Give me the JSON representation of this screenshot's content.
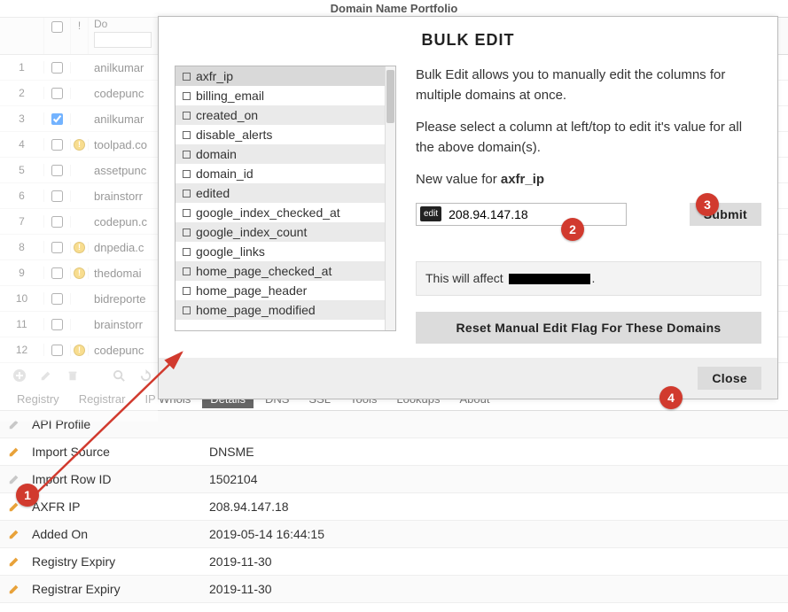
{
  "page_title": "Domain Name Portfolio",
  "grid": {
    "col_domain_label": "Do",
    "warn_label": "!",
    "rows": [
      {
        "n": "1",
        "chk": false,
        "warn": false,
        "domain": "anilkumar"
      },
      {
        "n": "2",
        "chk": false,
        "warn": false,
        "domain": "codepunc"
      },
      {
        "n": "3",
        "chk": true,
        "warn": false,
        "domain": "anilkumar"
      },
      {
        "n": "4",
        "chk": false,
        "warn": true,
        "domain": "toolpad.co"
      },
      {
        "n": "5",
        "chk": false,
        "warn": false,
        "domain": "assetpunc"
      },
      {
        "n": "6",
        "chk": false,
        "warn": false,
        "domain": "brainstorr"
      },
      {
        "n": "7",
        "chk": false,
        "warn": false,
        "domain": "codepun.c"
      },
      {
        "n": "8",
        "chk": false,
        "warn": true,
        "domain": "dnpedia.c"
      },
      {
        "n": "9",
        "chk": false,
        "warn": true,
        "domain": "thedomai"
      },
      {
        "n": "10",
        "chk": false,
        "warn": false,
        "domain": "bidreporte"
      },
      {
        "n": "11",
        "chk": false,
        "warn": false,
        "domain": "brainstorr"
      },
      {
        "n": "12",
        "chk": false,
        "warn": true,
        "domain": "codepunc"
      }
    ]
  },
  "tabs": [
    "Registry",
    "Registrar",
    "IP Whois",
    "Details",
    "DNS",
    "SSL",
    "Tools",
    "Lookups",
    "About"
  ],
  "tabs_active_index": 3,
  "details": [
    {
      "icon": "gray",
      "label": "API Profile",
      "value": ""
    },
    {
      "icon": "orange",
      "label": "Import Source",
      "value": "DNSME"
    },
    {
      "icon": "gray",
      "label": "Import Row ID",
      "value": "1502104"
    },
    {
      "icon": "orange",
      "label": "AXFR IP",
      "value": "208.94.147.18"
    },
    {
      "icon": "orange",
      "label": "Added On",
      "value": "2019-05-14 16:44:15"
    },
    {
      "icon": "orange",
      "label": "Registry Expiry",
      "value": "2019-11-30"
    },
    {
      "icon": "orange",
      "label": "Registrar Expiry",
      "value": "2019-11-30"
    }
  ],
  "modal": {
    "title": "BULK EDIT",
    "columns": [
      "axfr_ip",
      "billing_email",
      "created_on",
      "disable_alerts",
      "domain",
      "domain_id",
      "edited",
      "google_index_checked_at",
      "google_index_count",
      "google_links",
      "home_page_checked_at",
      "home_page_header",
      "home_page_modified"
    ],
    "intro1": "Bulk Edit allows you to manually edit the columns for multiple domains at once.",
    "intro2": "Please select a column at left/top to edit it's value for all the above domain(s).",
    "new_value_label_prefix": "New value for ",
    "selected_column": "axfr_ip",
    "edit_badge": "edit",
    "input_value": "208.94.147.18",
    "submit_label": "Submit",
    "affect_prefix": "This will affect ",
    "affect_suffix": ".",
    "reset_label": "Reset Manual Edit Flag For These Domains",
    "close_label": "Close"
  },
  "callouts": {
    "1": "1",
    "2": "2",
    "3": "3",
    "4": "4"
  }
}
